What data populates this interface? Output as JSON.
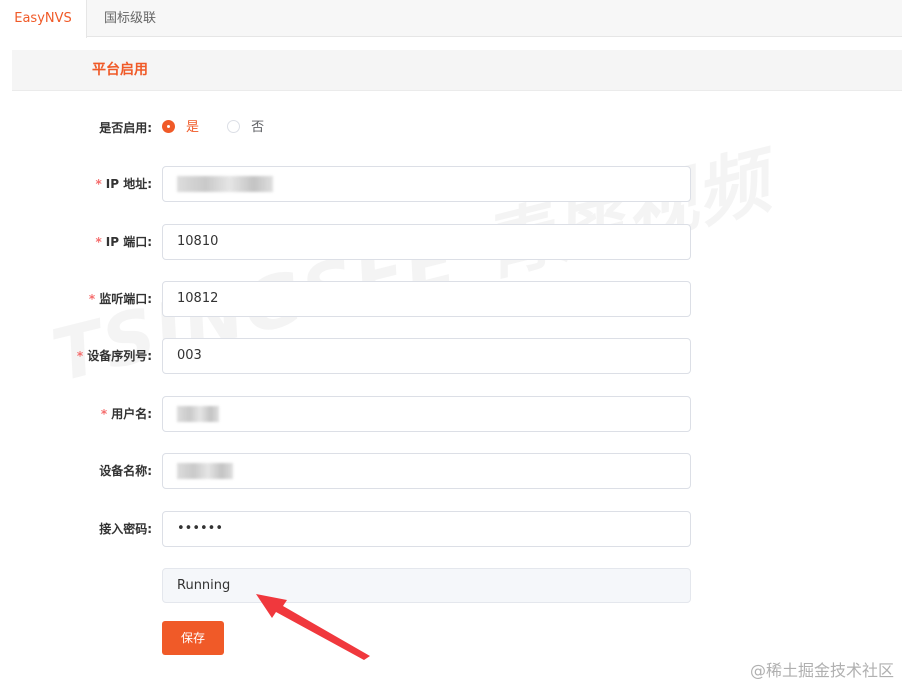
{
  "tabs": [
    {
      "label": "EasyNVS",
      "active": true
    },
    {
      "label": "国标级联",
      "active": false
    }
  ],
  "section": {
    "title": "平台启用"
  },
  "form": {
    "enabled": {
      "label": "是否启用:",
      "options": [
        "是",
        "否"
      ],
      "selected": "是"
    },
    "ip_address": {
      "label": "IP 地址:",
      "required": true,
      "value": ""
    },
    "ip_port": {
      "label": "IP 端口:",
      "required": true,
      "value": "10810"
    },
    "listen_port": {
      "label": "监听端口:",
      "required": true,
      "value": "10812"
    },
    "device_serial": {
      "label": "设备序列号:",
      "required": true,
      "value": "003"
    },
    "username": {
      "label": "用户名:",
      "required": true,
      "value": ""
    },
    "device_name": {
      "label": "设备名称:",
      "required": false,
      "value": ""
    },
    "access_password": {
      "label": "接入密码:",
      "required": false,
      "value": "••••••"
    },
    "status": {
      "value": "Running"
    }
  },
  "actions": {
    "save_label": "保存"
  },
  "watermark": "TSINGSEE 青犀视频",
  "footer_credit": "@稀土掘金技术社区",
  "colors": {
    "accent": "#f05a28",
    "required": "#f56c6c",
    "annotation_arrow": "#f0383d"
  }
}
